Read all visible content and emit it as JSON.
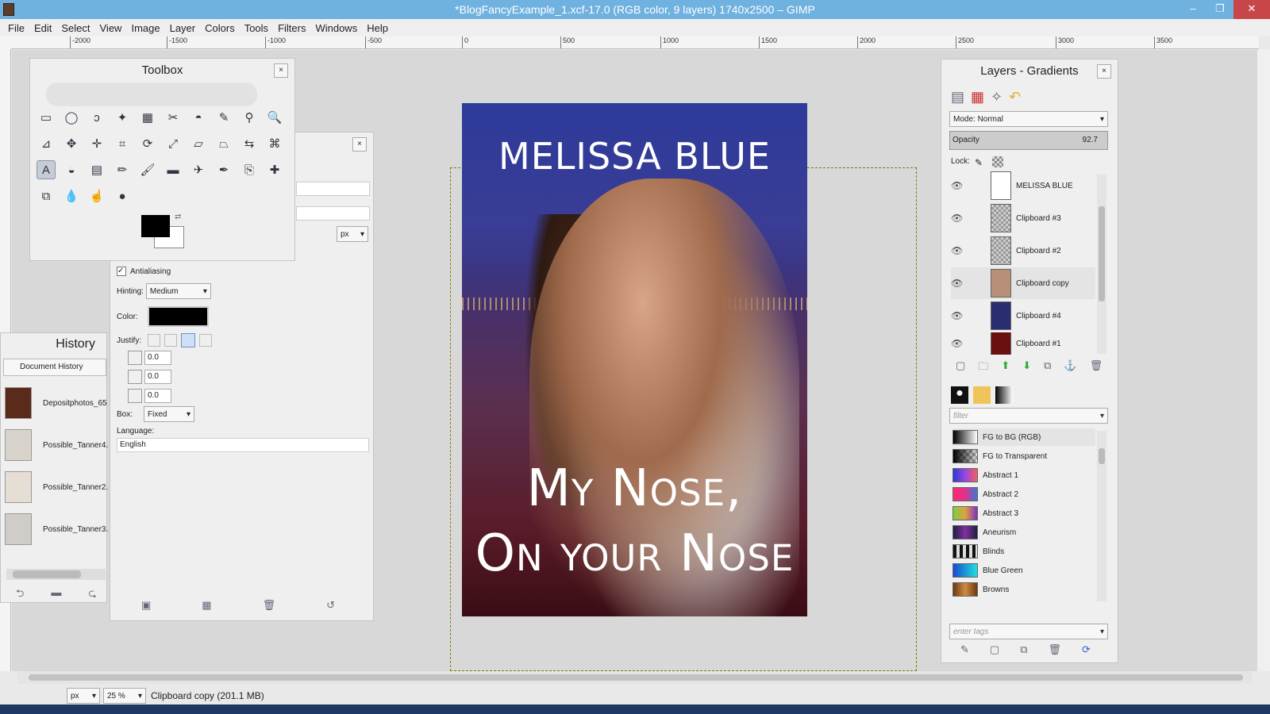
{
  "window": {
    "title": "*BlogFancyExample_1.xcf-17.0 (RGB color, 9 layers) 1740x2500 – GIMP",
    "minimize": "–",
    "maximize": "❐",
    "close": "✕"
  },
  "menu": [
    "File",
    "Edit",
    "Select",
    "View",
    "Image",
    "Layer",
    "Colors",
    "Tools",
    "Filters",
    "Windows",
    "Help"
  ],
  "ruler": {
    "ticks": [
      "-2000",
      "-1500",
      "-1000",
      "-500",
      "0",
      "500",
      "1000",
      "1500",
      "2000",
      "2500",
      "3000",
      "3500"
    ]
  },
  "cover": {
    "author": "MELISSA BLUE",
    "title_line1": "My Nose,",
    "title_line2": "On your Nose"
  },
  "toolbox": {
    "title": "Toolbox",
    "close": "×",
    "tools": [
      "rect-select-icon",
      "ellipse-select-icon",
      "free-select-icon",
      "fuzzy-select-icon",
      "color-select-icon",
      "scissors-icon",
      "foreground-select-icon",
      "paths-icon",
      "color-picker-icon",
      "zoom-icon",
      "measure-icon",
      "move-icon",
      "align-icon",
      "crop-icon",
      "rotate-icon",
      "scale-icon",
      "shear-icon",
      "perspective-icon",
      "flip-icon",
      "cage-icon",
      "text-icon",
      "bucket-fill-icon",
      "blend-icon",
      "pencil-icon",
      "paintbrush-icon",
      "eraser-icon",
      "airbrush-icon",
      "ink-icon",
      "clone-icon",
      "heal-icon",
      "perspective-clone-icon",
      "blur-icon",
      "smudge-icon",
      "dodge-icon"
    ],
    "glyphs": [
      "▭",
      "◯",
      "ↄ",
      "✦",
      "▦",
      "✂",
      "◓",
      "✎",
      "⚲",
      "🔍",
      "⊿",
      "✥",
      "✛",
      "⌗",
      "⟳",
      "⤢",
      "▱",
      "⏢",
      "⇆",
      "⌘",
      "A",
      "◒",
      "▤",
      "✏",
      "🖌",
      "▬",
      "✈",
      "✒",
      "⎘",
      "✚",
      "⧉",
      "💧",
      "☝",
      "●"
    ]
  },
  "tool_options": {
    "antialiasing_label": "Antialiasing",
    "hinting_label": "Hinting:",
    "hinting_value": "Medium",
    "color_label": "Color:",
    "justify_label": "Justify:",
    "indent_value": "0.0",
    "line_spacing_value": "0.0",
    "letter_spacing_value": "0.0",
    "box_label": "Box:",
    "box_value": "Fixed",
    "language_label": "Language:",
    "language_value": "English",
    "unit_value": "px"
  },
  "history": {
    "title": "History",
    "tab": "Document History",
    "items": [
      "Depositphotos_65",
      "Possible_Tanner4.",
      "Possible_Tanner2.",
      "Possible_Tanner3."
    ]
  },
  "layers": {
    "title": "Layers - Gradients",
    "close": "×",
    "mode_label": "Mode: Normal",
    "opacity_label": "Opacity",
    "opacity_value": "92.7",
    "lock_label": "Lock:",
    "items": [
      "MELISSA BLUE",
      "Clipboard #3",
      "Clipboard #2",
      "Clipboard copy",
      "Clipboard #4",
      "Clipboard #1"
    ]
  },
  "gradients": {
    "filter_placeholder": "filter",
    "tags_placeholder": "enter tags",
    "items": [
      {
        "name": "FG to BG (RGB)",
        "c": "linear-gradient(90deg,#000,#fff)"
      },
      {
        "name": "FG to Transparent",
        "c": "linear-gradient(90deg,#000,rgba(0,0,0,0)),repeating-conic-gradient(#999 0 25%,#ddd 0 50%) 0 0/8px 8px"
      },
      {
        "name": "Abstract 1",
        "c": "linear-gradient(90deg,#2a3bd6,#9a45e0,#f06060)"
      },
      {
        "name": "Abstract 2",
        "c": "linear-gradient(90deg,#ff2a6a,#e03090,#3a7ad0)"
      },
      {
        "name": "Abstract 3",
        "c": "linear-gradient(90deg,#7ad040,#e0a040,#8030c0)"
      },
      {
        "name": "Aneurism",
        "c": "linear-gradient(90deg,#202040,#8030a0,#202040)"
      },
      {
        "name": "Blinds",
        "c": "repeating-linear-gradient(90deg,#111 0 4px,#ddd 4px 8px)"
      },
      {
        "name": "Blue Green",
        "c": "linear-gradient(90deg,#1a4ad0,#20e0e0)"
      },
      {
        "name": "Browns",
        "c": "linear-gradient(90deg,#6a3a10,#d08a40,#6a3a10)"
      }
    ]
  },
  "status": {
    "unit": "px",
    "zoom": "25 %",
    "message": "Clipboard copy (201.1 MB)"
  }
}
